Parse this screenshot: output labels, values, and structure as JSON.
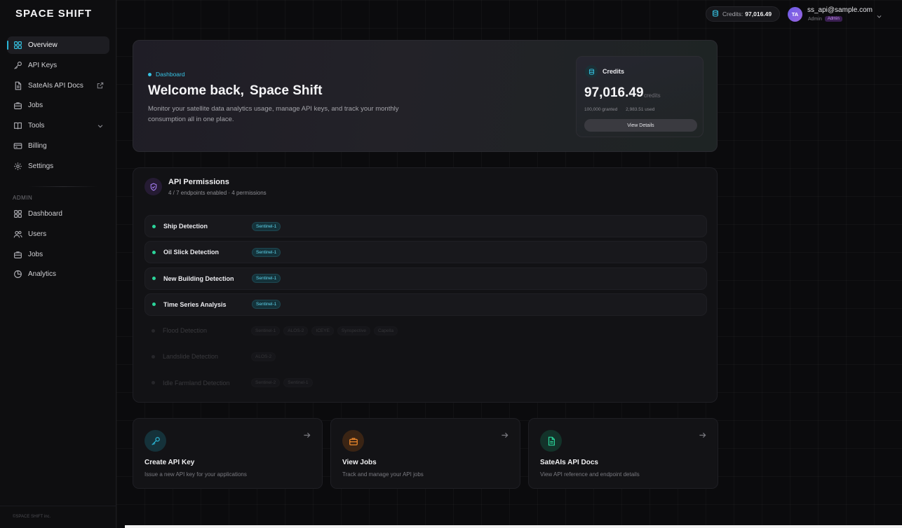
{
  "brand": {
    "logo": "SPACE SHIFT",
    "copyright": "©SPACE SHIFT inc."
  },
  "sidebar": {
    "items": [
      {
        "label": "Overview",
        "icon": "grid-icon",
        "active": true
      },
      {
        "label": "API Keys",
        "icon": "key-icon"
      },
      {
        "label": "SateAIs API Docs",
        "icon": "document-icon",
        "trail": "external-link-icon"
      },
      {
        "label": "Jobs",
        "icon": "briefcase-icon"
      },
      {
        "label": "Tools",
        "icon": "book-icon",
        "trail": "chevron-down-icon"
      },
      {
        "label": "Billing",
        "icon": "credit-card-icon"
      },
      {
        "label": "Settings",
        "icon": "gear-icon"
      }
    ],
    "admin_label": "ADMIN",
    "admin_items": [
      {
        "label": "Dashboard",
        "icon": "grid-icon"
      },
      {
        "label": "Users",
        "icon": "users-icon"
      },
      {
        "label": "Jobs",
        "icon": "briefcase-icon"
      },
      {
        "label": "Analytics",
        "icon": "chart-icon"
      }
    ]
  },
  "topbar": {
    "credits_label": "Credits:",
    "credits_value": "97,016.49",
    "avatar_initials": "TA",
    "email": "ss_api@sample.com",
    "role": "Admin",
    "role_badge": "Admin"
  },
  "hero": {
    "crumb": "Dashboard",
    "title_prefix": "Welcome back,",
    "title_name": "Space Shift",
    "description": "Monitor your satellite data analytics usage, manage API keys, and track your monthly consumption all in one place.",
    "credits": {
      "title": "Credits",
      "value": "97,016.49",
      "unit": "credits",
      "granted": "100,000 granted",
      "used": "2,983.51 used",
      "button": "View Details"
    }
  },
  "permissions": {
    "title": "API Permissions",
    "subtitle": "4 / 7 endpoints enabled · 4 permissions",
    "rows": [
      {
        "name": "Ship Detection",
        "enabled": true,
        "tags": [
          "Sentinel-1"
        ]
      },
      {
        "name": "Oil Slick Detection",
        "enabled": true,
        "tags": [
          "Sentinel-1"
        ]
      },
      {
        "name": "New Building Detection",
        "enabled": true,
        "tags": [
          "Sentinel-1"
        ]
      },
      {
        "name": "Time Series Analysis",
        "enabled": true,
        "tags": [
          "Sentinel-1"
        ]
      },
      {
        "name": "Flood Detection",
        "enabled": false,
        "tags": [
          "Sentinel-1",
          "ALOS-2",
          "ICEYE",
          "Synspective",
          "Capella"
        ]
      },
      {
        "name": "Landslide Detection",
        "enabled": false,
        "tags": [
          "ALOS-2"
        ]
      },
      {
        "name": "Idle Farmland Detection",
        "enabled": false,
        "tags": [
          "Sentinel-2",
          "Sentinel-1"
        ]
      }
    ]
  },
  "quick_cards": [
    {
      "title": "Create API Key",
      "desc": "Issue a new API key for your applications",
      "icon": "key-icon",
      "color": "#2bb6d6",
      "bg": "#15323a"
    },
    {
      "title": "View Jobs",
      "desc": "Track and manage your API jobs",
      "icon": "briefcase-icon",
      "color": "#f08a2c",
      "bg": "#3a2414"
    },
    {
      "title": "SateAIs API Docs",
      "desc": "View API reference and endpoint details",
      "icon": "document-icon",
      "color": "#2bd49a",
      "bg": "#13332a"
    }
  ],
  "colors": {
    "accent": "#29b6d8",
    "enabled": "#2bd49a",
    "admin_badge": "#c690f3"
  }
}
